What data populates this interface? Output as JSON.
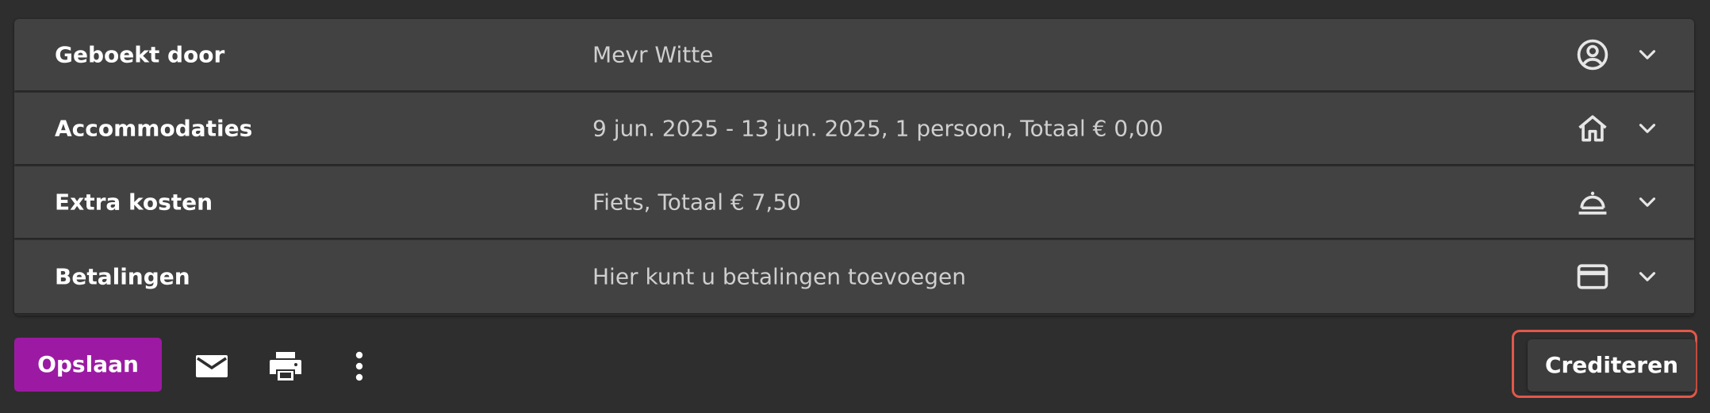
{
  "rows": [
    {
      "label": "Geboekt door",
      "value": "Mevr Witte",
      "icon": "account-circle-icon"
    },
    {
      "label": "Accommodaties",
      "value": "9 jun. 2025 - 13 jun. 2025, 1 persoon, Totaal € 0,00",
      "icon": "home-icon"
    },
    {
      "label": "Extra kosten",
      "value": "Fiets, Totaal € 7,50",
      "icon": "room-service-icon"
    },
    {
      "label": "Betalingen",
      "value": "Hier kunt u betalingen toevoegen",
      "icon": "credit-card-icon"
    }
  ],
  "footer": {
    "save_label": "Opslaan",
    "credit_label": "Crediteren",
    "icons": [
      "mail-icon",
      "print-icon",
      "more-vert-icon"
    ]
  },
  "colors": {
    "background": "#2e2e2e",
    "row": "#424242",
    "save_button": "#9c1aa3",
    "highlight_outline": "#e2584a"
  }
}
